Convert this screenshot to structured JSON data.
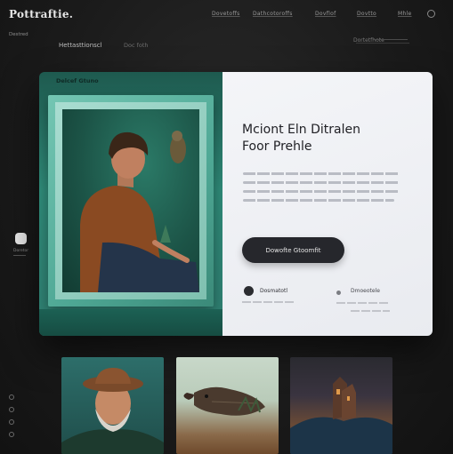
{
  "header": {
    "brand": "Pottraftie.",
    "subbrand": "Destred",
    "nav": [
      "Dovetoffs",
      "Dathcotoroffs",
      "Dovflof",
      "Dovtto",
      "Mhle"
    ],
    "crumb_active": "Hettasttionscl",
    "crumb_inactive": "Doc foth",
    "right_label": "Dortetfhote"
  },
  "sidebar": {
    "label": "Doretor"
  },
  "hero": {
    "panel_label": "Delcef Gtuno",
    "title_line1": "Mciont Eln Ditralen",
    "title_line2": "Foor Prehle",
    "cta_label": "Dowofte Gtoomfit",
    "meta_left": "Dosmatotl",
    "meta_right": "Dmoeotele"
  },
  "colors": {
    "accent_teal": "#2f8a78",
    "panel_light": "#f1f2f5",
    "cta_dark": "#26272c",
    "page_bg": "#1b1b1b"
  },
  "icons": [
    "search-icon",
    "circle-nav-icon"
  ]
}
